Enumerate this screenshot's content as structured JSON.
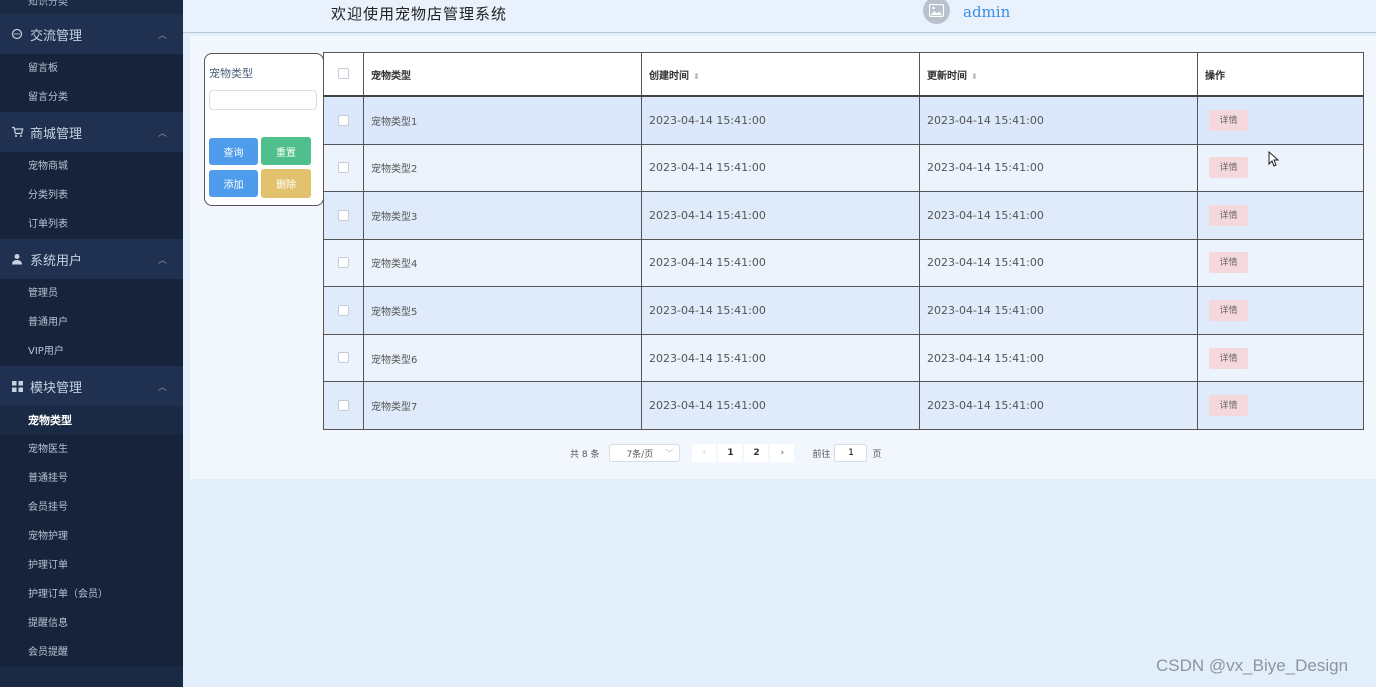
{
  "sidebar": {
    "top_stub": "知识分类",
    "groups": [
      {
        "label": "交流管理",
        "icon": "chat-icon",
        "items": [
          "留言板",
          "留言分类"
        ]
      },
      {
        "label": "商城管理",
        "icon": "cart-icon",
        "items": [
          "宠物商城",
          "分类列表",
          "订单列表"
        ]
      },
      {
        "label": "系统用户",
        "icon": "user-icon",
        "items": [
          "管理员",
          "普通用户",
          "VIP用户"
        ]
      },
      {
        "label": "模块管理",
        "icon": "grid-icon",
        "items": [
          "宠物类型",
          "宠物医生",
          "普通挂号",
          "会员挂号",
          "宠物护理",
          "护理订单",
          "护理订单（会员）",
          "提醒信息",
          "会员提醒"
        ]
      }
    ],
    "active_item": "宠物类型"
  },
  "header": {
    "title": "欢迎使用宠物店管理系统",
    "username": "admin"
  },
  "search": {
    "label": "宠物类型",
    "value": "",
    "placeholder": "",
    "query_label": "查询",
    "reset_label": "重置",
    "add_label": "添加",
    "delete_label": "删除"
  },
  "table": {
    "columns": [
      "宠物类型",
      "创建时间",
      "更新时间",
      "操作"
    ],
    "rows": [
      {
        "type": "宠物类型1",
        "created": "2023-04-14 15:41:00",
        "updated": "2023-04-14 15:41:00"
      },
      {
        "type": "宠物类型2",
        "created": "2023-04-14 15:41:00",
        "updated": "2023-04-14 15:41:00"
      },
      {
        "type": "宠物类型3",
        "created": "2023-04-14 15:41:00",
        "updated": "2023-04-14 15:41:00"
      },
      {
        "type": "宠物类型4",
        "created": "2023-04-14 15:41:00",
        "updated": "2023-04-14 15:41:00"
      },
      {
        "type": "宠物类型5",
        "created": "2023-04-14 15:41:00",
        "updated": "2023-04-14 15:41:00"
      },
      {
        "type": "宠物类型6",
        "created": "2023-04-14 15:41:00",
        "updated": "2023-04-14 15:41:00"
      },
      {
        "type": "宠物类型7",
        "created": "2023-04-14 15:41:00",
        "updated": "2023-04-14 15:41:00"
      }
    ],
    "detail_label": "详情"
  },
  "pagination": {
    "total": "共 8 条",
    "page_size": "7条/页",
    "pages": [
      "1",
      "2"
    ],
    "goto_label": "前往",
    "goto_value": "1",
    "goto_unit": "页"
  },
  "watermark": "CSDN @vx_Biye_Design",
  "colors": {
    "sidebar_bg": "#1b2a44",
    "primary": "#4e9ceb",
    "success": "#4fc08d",
    "warning": "#e2c26d",
    "danger_light": "#f5d8dc",
    "accent_text": "#3c8fe0"
  }
}
